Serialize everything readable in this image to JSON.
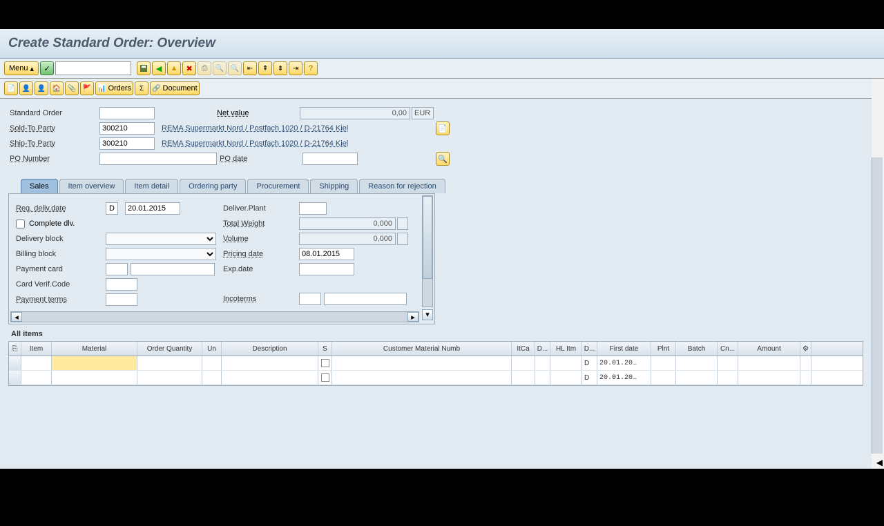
{
  "title": "Create Standard Order: Overview",
  "menu_label": "Menu",
  "toolbar2": {
    "orders": "Orders",
    "document": "Document"
  },
  "header": {
    "std_order_label": "Standard Order",
    "net_value_label": "Net value",
    "net_value": "0,00",
    "currency": "EUR",
    "sold_to_label": "Sold-To Party",
    "sold_to": "300210",
    "sold_to_desc": "REMA Supermarkt Nord / Postfach 1020 / D-21764 Kiel",
    "ship_to_label": "Ship-To Party",
    "ship_to": "300210",
    "ship_to_desc": "REMA Supermarkt Nord / Postfach 1020 / D-21764 Kiel",
    "po_number_label": "PO Number",
    "po_date_label": "PO date"
  },
  "tabs": [
    "Sales",
    "Item overview",
    "Item detail",
    "Ordering party",
    "Procurement",
    "Shipping",
    "Reason for rejection"
  ],
  "sales": {
    "req_deliv_label": "Req. deliv.date",
    "date_type": "D",
    "req_deliv_date": "20.01.2015",
    "complete_dlv_label": "Complete dlv.",
    "delivery_block_label": "Delivery block",
    "billing_block_label": "Billing block",
    "payment_card_label": "Payment card",
    "card_verif_label": "Card Verif.Code",
    "payment_terms_label": "Payment terms",
    "deliver_plant_label": "Deliver.Plant",
    "total_weight_label": "Total Weight",
    "total_weight": "0,000",
    "volume_label": "Volume",
    "volume": "0,000",
    "pricing_date_label": "Pricing date",
    "pricing_date": "08.01.2015",
    "exp_date_label": "Exp.date",
    "incoterms_label": "Incoterms"
  },
  "items": {
    "section_label": "All items",
    "columns": [
      "",
      "Item",
      "Material",
      "Order Quantity",
      "Un",
      "Description",
      "S",
      "Customer Material Numb",
      "ItCa",
      "D...",
      "HL Itm",
      "D...",
      "First date",
      "Plnt",
      "Batch",
      "Cn...",
      "Amount",
      ""
    ],
    "rows": [
      {
        "d2": "D",
        "first_date": "20.01.20…"
      },
      {
        "d2": "D",
        "first_date": "20.01.20…"
      }
    ]
  }
}
